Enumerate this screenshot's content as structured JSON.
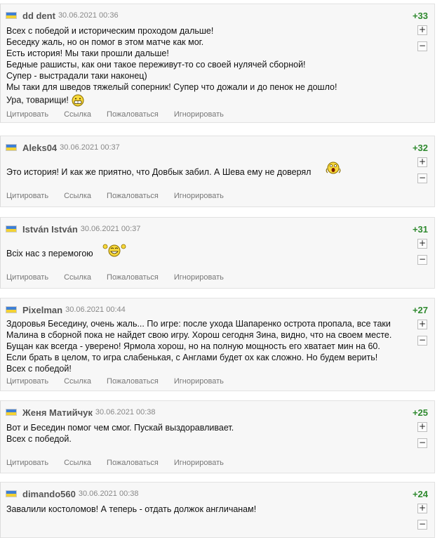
{
  "actions": {
    "quote": "Цитировать",
    "link": "Ссылка",
    "report": "Пожаловаться",
    "ignore": "Игнорировать"
  },
  "vote": {
    "up": "+",
    "down": "−"
  },
  "comments": [
    {
      "author": "dd dent",
      "date": "30.06.2021 00:36",
      "score": "+33",
      "lines": [
        "Всех с победой и историческим проходом дальше!",
        "Беседку жаль, но он помог в этом матче как мог.",
        "Есть история! Мы таки прошли дальше!",
        "Бедные рашисты, как они такое переживут-то со своей нулячей сборной!",
        "Супер - выстрадали таки наконец)",
        "Мы таки для шведов тяжелый соперник! Супер что дожали и до пенок не дошло!",
        "Ура, товарищи!"
      ],
      "smile": "grin-smiley-icon"
    },
    {
      "author": "Aleks04",
      "date": "30.06.2021 00:37",
      "score": "+32",
      "lines": [
        "Это история! И как же приятно, что Довбык забил. А Шева ему не доверял"
      ],
      "smile": "scream-smiley-icon"
    },
    {
      "author": "István István",
      "date": "30.06.2021 00:37",
      "score": "+31",
      "lines": [
        "Всіх нас з перемогою"
      ],
      "smile": "cheer-smiley-icon"
    },
    {
      "author": "Pixelman",
      "date": "30.06.2021 00:44",
      "score": "+27",
      "lines": [
        "Здоровья Беседину, очень жаль... По игре: после ухода Шапаренко острота пропала, все таки",
        "Малина в сборной пока не найдет свою игру. Хорош сегодня Зина, видно, что на своем месте.",
        "Бущан как всегда - уверено! Ярмола хорош, но на полную мощность его хватает мин на 60.",
        "Если брать в целом, то игра слабенькая, с Англами будет ох как сложно. Но будем верить!",
        "Всех с победой!"
      ]
    },
    {
      "author": "Женя Матийчук",
      "date": "30.06.2021 00:38",
      "score": "+25",
      "lines": [
        "Вот и Беседин помог чем смог. Пускай выздоравливает.",
        "Всех с победой."
      ]
    },
    {
      "author": "dimando560",
      "date": "30.06.2021 00:38",
      "score": "+24",
      "lines": [
        "Завалили костоломов! А теперь - отдать должок англичанам!"
      ]
    }
  ]
}
